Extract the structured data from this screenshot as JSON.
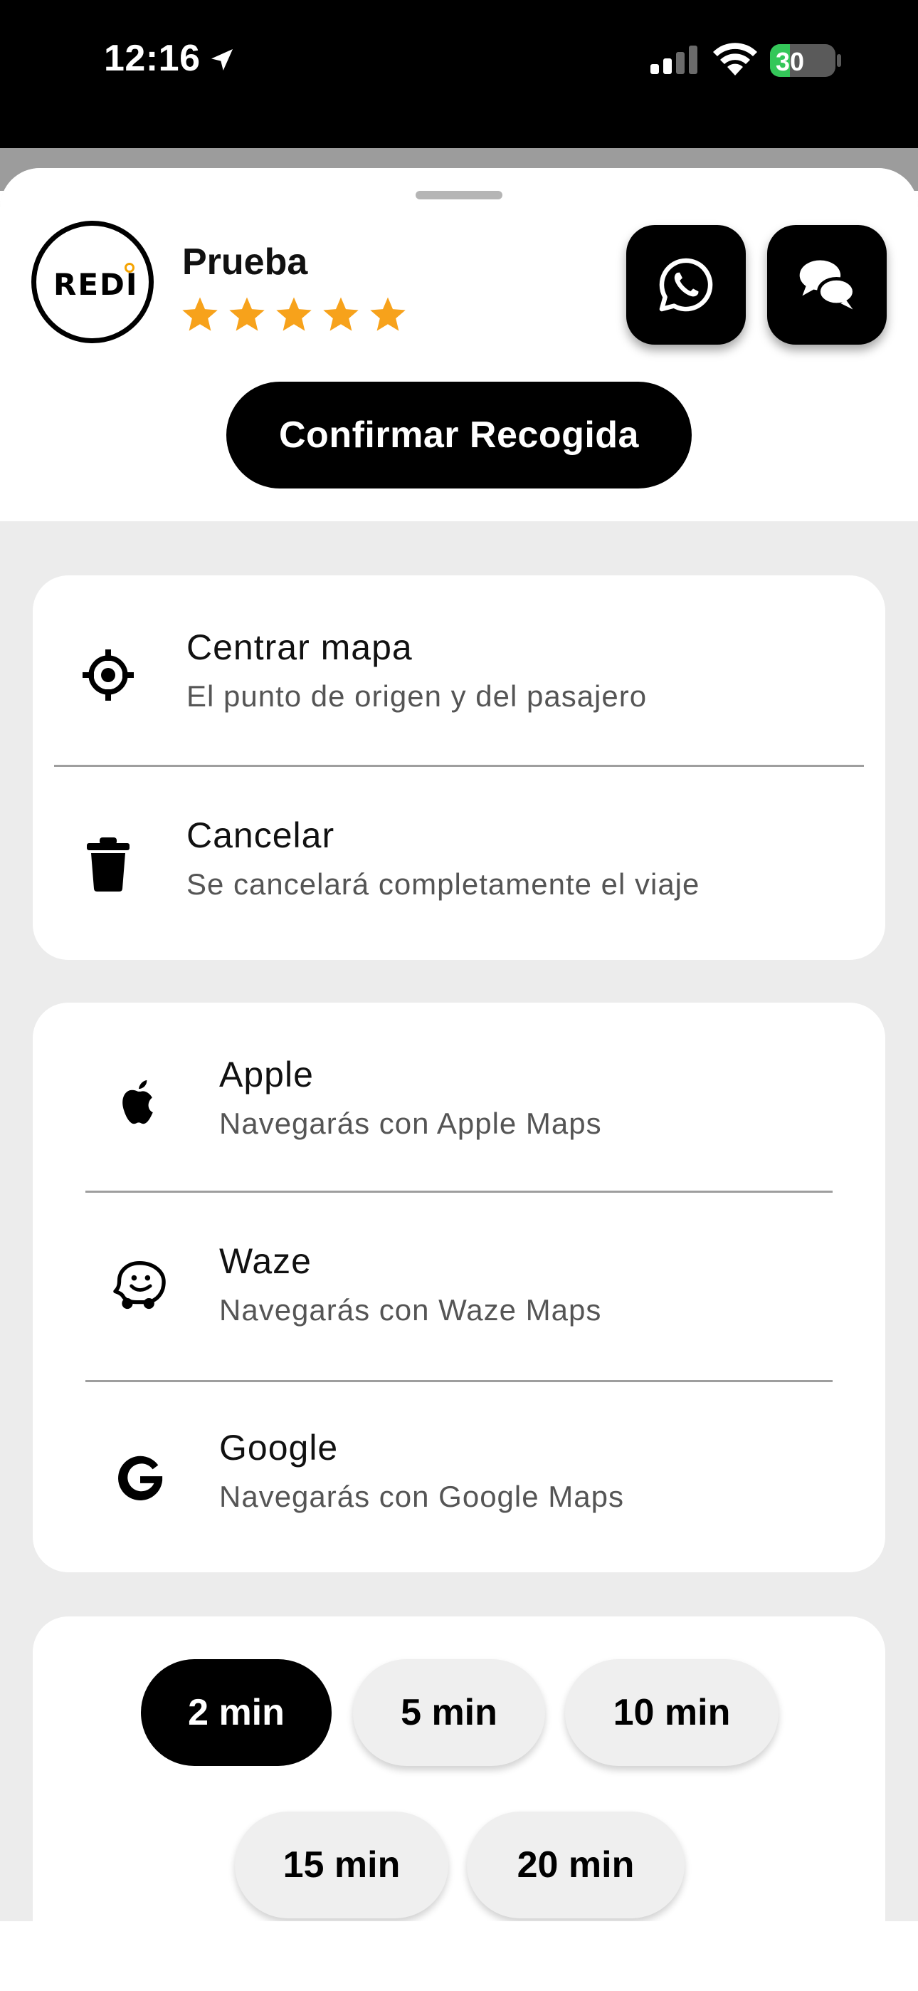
{
  "status_bar": {
    "time": "12:16",
    "battery": "30",
    "battery_level": 0.3
  },
  "driver": {
    "logo_text": "REDI",
    "name": "Prueba",
    "rating": 5
  },
  "actions": {
    "whatsapp_icon": "whatsapp-icon",
    "chat_icon": "chat-bubbles-icon",
    "confirm_label": "Confirmar Recogida"
  },
  "options": [
    {
      "icon": "crosshair-icon",
      "title": "Centrar mapa",
      "subtitle": "El punto de origen y del pasajero"
    },
    {
      "icon": "trash-icon",
      "title": "Cancelar",
      "subtitle": "Se cancelará completamente el viaje"
    }
  ],
  "navigation": [
    {
      "icon": "apple-icon",
      "title": "Apple",
      "subtitle": "Navegarás con Apple Maps"
    },
    {
      "icon": "waze-icon",
      "title": "Waze",
      "subtitle": "Navegarás con Waze Maps"
    },
    {
      "icon": "google-icon",
      "title": "Google",
      "subtitle": "Navegarás con Google Maps"
    }
  ],
  "wait_times": {
    "selected": "2 min",
    "options": [
      "2 min",
      "5 min",
      "10 min",
      "15 min",
      "20 min"
    ]
  },
  "colors": {
    "accent": "#000000",
    "star": "#f7a21b",
    "battery": "#34c759"
  }
}
